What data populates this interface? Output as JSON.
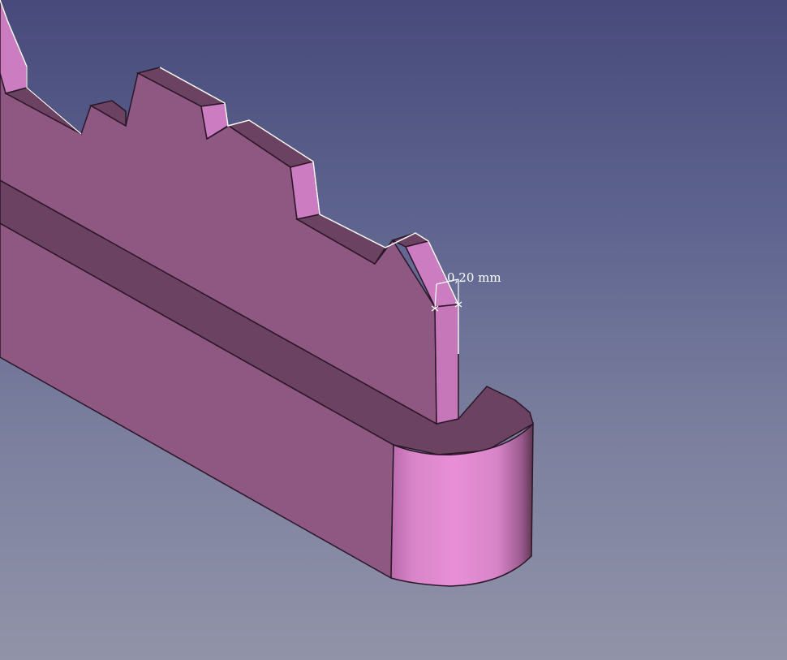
{
  "viewport": {
    "background_top": "#474a7a",
    "background_bottom": "#9193a8",
    "model_color": "#8e5883",
    "model_dark_color": "#6b4262",
    "model_highlight_color": "#cc7cc0",
    "edge_color": "#2a1626",
    "selection_color": "#ffffff"
  },
  "dimension": {
    "label": "0,20 mm"
  }
}
